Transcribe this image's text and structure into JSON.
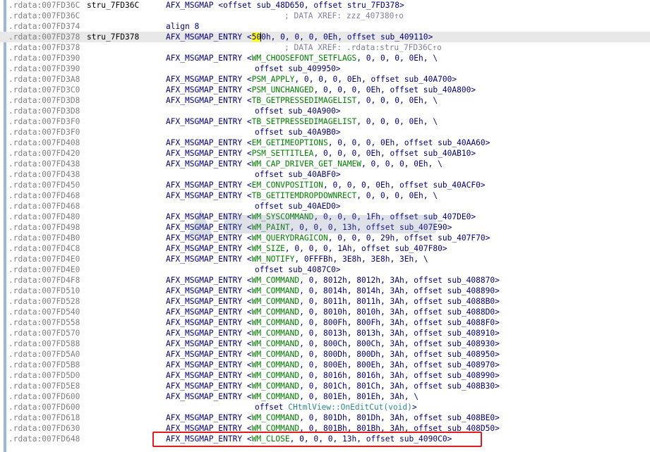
{
  "rows": [
    {
      "addr": ".rdata:007FD36C",
      "label": "stru_7FD36C",
      "code": "AFX_MSGMAP <offset sub_48D650, offset stru_7FD378>"
    },
    {
      "addr": ".rdata:007FD36C",
      "xref": "; DATA XREF: zzz_407380↑o"
    },
    {
      "addr": ".rdata:007FD374",
      "code": "align 8"
    },
    {
      "addr": ".rdata:007FD378",
      "label": "stru_7FD378",
      "code_pre": "AFX_MSGMAP_ENTRY <",
      "code_hl": "50",
      "code_post": "0h, 0, 0, 0, 0Eh, offset sub_409110>",
      "current": true
    },
    {
      "addr": ".rdata:007FD378",
      "xref": "; DATA XREF: .rdata:stru_7FD36C↑o"
    },
    {
      "addr": ".rdata:007FD390",
      "msg": "WM_CHOOSEFONT_SETFLAGS",
      "args": ", 0, 0, 0, 0Eh, \\"
    },
    {
      "addr": ".rdata:007FD390",
      "cont": "offset sub_409950>"
    },
    {
      "addr": ".rdata:007FD3A8",
      "msg": "PSM_APPLY",
      "args": ", 0, 0, 0, 0Eh, offset sub_40A700>"
    },
    {
      "addr": ".rdata:007FD3C0",
      "msg": "PSM_UNCHANGED",
      "args": ", 0, 0, 0, 0Eh, offset sub_40A800>"
    },
    {
      "addr": ".rdata:007FD3D8",
      "msg": "TB_GETPRESSEDIMAGELIST",
      "args": ", 0, 0, 0, 0Eh, \\"
    },
    {
      "addr": ".rdata:007FD3D8",
      "cont": "offset sub_40A900>"
    },
    {
      "addr": ".rdata:007FD3F0",
      "msg": "TB_SETPRESSEDIMAGELIST",
      "args": ", 0, 0, 0, 0Eh, \\"
    },
    {
      "addr": ".rdata:007FD3F0",
      "cont": "offset sub_40A9B0>"
    },
    {
      "addr": ".rdata:007FD408",
      "msg": "EM_GETIMEOPTIONS",
      "args": ", 0, 0, 0, 0Eh, offset sub_40AA60>"
    },
    {
      "addr": ".rdata:007FD420",
      "msg": "PSM_SETTITLEA",
      "args": ", 0, 0, 0, 0Eh, offset sub_40AB10>"
    },
    {
      "addr": ".rdata:007FD438",
      "msg": "WM_CAP_DRIVER_GET_NAMEW",
      "args": ", 0, 0, 0, 0Eh, \\"
    },
    {
      "addr": ".rdata:007FD438",
      "cont": "offset sub_40ABF0>"
    },
    {
      "addr": ".rdata:007FD450",
      "msg": "EM_CONVPOSITION",
      "args": ", 0, 0, 0, 0Eh, offset sub_40ACF0>"
    },
    {
      "addr": ".rdata:007FD468",
      "msg": "TB_GETITEMDROPDOWNRECT",
      "args": ", 0, 0, 0, 0Eh, \\"
    },
    {
      "addr": ".rdata:007FD468",
      "cont": "offset sub_40AED0>"
    },
    {
      "addr": ".rdata:007FD480",
      "msg": "WM_SYSCOMMAND",
      "args": ", 0, 0, 0, 1Fh, offset sub_407DE0>"
    },
    {
      "addr": ".rdata:007FD498",
      "msg": "WM_PAINT",
      "args": ", 0, 0, 0, 13h, offset sub_407E90>"
    },
    {
      "addr": ".rdata:007FD4B0",
      "msg": "WM_QUERYDRAGICON",
      "args": ", 0, 0, 0, 29h, offset sub_407F70>"
    },
    {
      "addr": ".rdata:007FD4C8",
      "msg": "WM_SIZE",
      "args": ", 0, 0, 0, 1Ah, offset sub_407F80>"
    },
    {
      "addr": ".rdata:007FD4E0",
      "msg": "WM_NOTIFY",
      "args": ", 0FFFBh, 3E8h, 3E8h, 3Eh, \\"
    },
    {
      "addr": ".rdata:007FD4E0",
      "cont": "offset sub_4087C0>"
    },
    {
      "addr": ".rdata:007FD4F8",
      "msg": "WM_COMMAND",
      "args": ", 0, 8012h, 8012h, 3Ah, offset sub_408870>"
    },
    {
      "addr": ".rdata:007FD510",
      "msg": "WM_COMMAND",
      "args": ", 0, 8014h, 8014h, 3Ah, offset sub_408890>"
    },
    {
      "addr": ".rdata:007FD528",
      "msg": "WM_COMMAND",
      "args": ", 0, 8011h, 8011h, 3Ah, offset sub_4088B0>"
    },
    {
      "addr": ".rdata:007FD540",
      "msg": "WM_COMMAND",
      "args": ", 0, 8010h, 8010h, 3Ah, offset sub_4088D0>"
    },
    {
      "addr": ".rdata:007FD558",
      "msg": "WM_COMMAND",
      "args": ", 0, 800Fh, 800Fh, 3Ah, offset sub_4088F0>"
    },
    {
      "addr": ".rdata:007FD570",
      "msg": "WM_COMMAND",
      "args": ", 0, 8013h, 8013h, 3Ah, offset sub_408910>"
    },
    {
      "addr": ".rdata:007FD588",
      "msg": "WM_COMMAND",
      "args": ", 0, 800Ch, 800Ch, 3Ah, offset sub_408930>"
    },
    {
      "addr": ".rdata:007FD5A0",
      "msg": "WM_COMMAND",
      "args": ", 0, 800Dh, 800Dh, 3Ah, offset sub_408950>"
    },
    {
      "addr": ".rdata:007FD5B8",
      "msg": "WM_COMMAND",
      "args": ", 0, 800Eh, 800Eh, 3Ah, offset sub_408970>"
    },
    {
      "addr": ".rdata:007FD5D0",
      "msg": "WM_COMMAND",
      "args": ", 0, 8016h, 8016h, 3Ah, offset sub_408990>"
    },
    {
      "addr": ".rdata:007FD5E8",
      "msg": "WM_COMMAND",
      "args": ", 0, 801Ch, 801Ch, 3Ah, offset sub_408B30>"
    },
    {
      "addr": ".rdata:007FD600",
      "msg": "WM_COMMAND",
      "args": ", 0, 801Eh, 801Eh, 3Ah, \\"
    },
    {
      "addr": ".rdata:007FD600",
      "cont_pre": "offset ",
      "cont_sym": "CHtmlView::OnEditCut(void)",
      "cont_post": ">"
    },
    {
      "addr": ".rdata:007FD618",
      "msg": "WM_COMMAND",
      "args": ", 0, 801Dh, 801Dh, 3Ah, offset sub_408BE0>"
    },
    {
      "addr": ".rdata:007FD630",
      "msg": "WM_COMMAND",
      "args": ", 0, 801Bh, 801Bh, 3Ah, offset sub_408D50>"
    },
    {
      "addr": ".rdata:007FD648",
      "msg": "WM_CLOSE",
      "args": ", 0, 0, 0, 13h, offset sub_4090C0>",
      "boxed": true
    }
  ],
  "entry_keyword": "AFX_MSGMAP_ENTRY <",
  "colors": {
    "highlight_box": "#e11b1b",
    "message_constant": "#008000",
    "symbol": "#2a8a8a",
    "caret_highlight": "#ffff00"
  }
}
